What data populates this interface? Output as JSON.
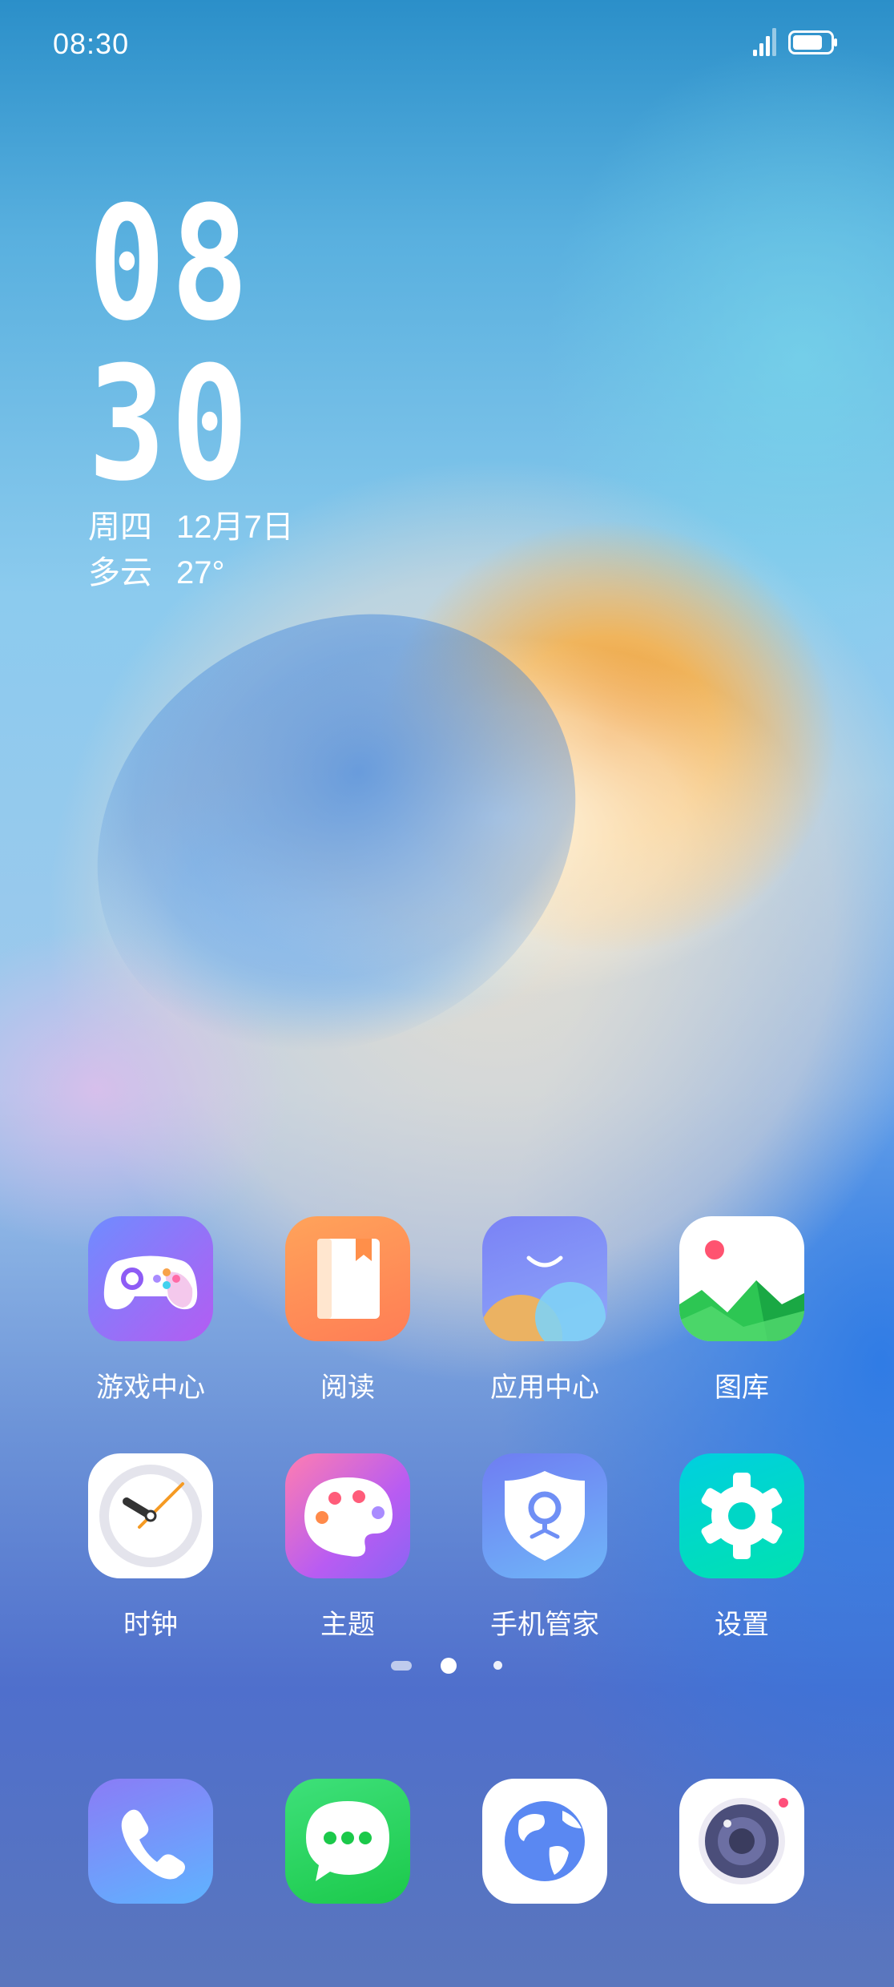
{
  "status_bar": {
    "time": "08:30"
  },
  "clock_widget": {
    "hour": "08",
    "minute": "30",
    "weekday": "周四",
    "date": "12月7日",
    "weather": "多云",
    "temperature": "27°"
  },
  "home_apps": [
    {
      "label": "游戏中心",
      "icon": "gamepad-icon"
    },
    {
      "label": "阅读",
      "icon": "book-icon"
    },
    {
      "label": "应用中心",
      "icon": "app-store-icon"
    },
    {
      "label": "图库",
      "icon": "gallery-icon"
    },
    {
      "label": "时钟",
      "icon": "clock-icon"
    },
    {
      "label": "主题",
      "icon": "palette-icon"
    },
    {
      "label": "手机管家",
      "icon": "phone-manager-shield-icon"
    },
    {
      "label": "设置",
      "icon": "gear-icon"
    }
  ],
  "dock_apps": [
    {
      "icon": "phone-icon"
    },
    {
      "icon": "messages-icon"
    },
    {
      "icon": "browser-globe-icon"
    },
    {
      "icon": "camera-icon"
    }
  ],
  "page_indicator": {
    "pages": 3,
    "current": 2
  },
  "colors": {
    "game": "#8e5cf5",
    "reading": "#ff8f4a",
    "app_store": "#7c86f2",
    "gallery_green": "#2dc653",
    "theme": "#c36cf0",
    "manager": "#6f8ff5",
    "settings": "#00d6c6",
    "phone": "#6d9bff",
    "messages": "#2fd65a"
  }
}
